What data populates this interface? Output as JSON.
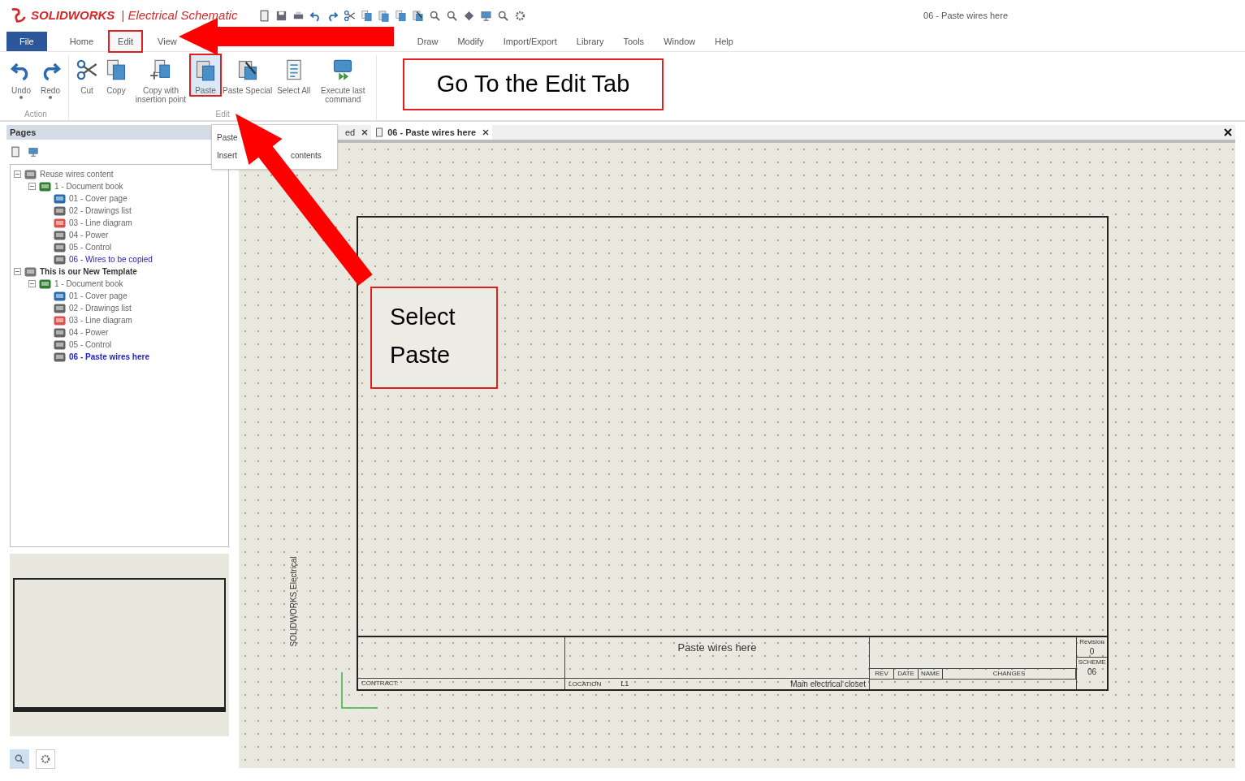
{
  "app": {
    "brand": "SOLIDWORKS",
    "separator": "|",
    "product": "Electrical Schematic",
    "document_title": "06 - Paste wires here"
  },
  "menu_tabs": [
    {
      "label": "File",
      "kind": "file",
      "selected": false
    },
    {
      "label": "Home",
      "kind": "tab",
      "selected": false
    },
    {
      "label": "Edit",
      "kind": "tab",
      "selected": true
    },
    {
      "label": "View",
      "kind": "tab",
      "selected": false
    },
    {
      "label": "Draw",
      "kind": "tab",
      "selected": false
    },
    {
      "label": "Modify",
      "kind": "tab",
      "selected": false
    },
    {
      "label": "Import/Export",
      "kind": "tab",
      "selected": false
    },
    {
      "label": "Library",
      "kind": "tab",
      "selected": false
    },
    {
      "label": "Tools",
      "kind": "tab",
      "selected": false
    },
    {
      "label": "Window",
      "kind": "tab",
      "selected": false
    },
    {
      "label": "Help",
      "kind": "tab",
      "selected": false
    }
  ],
  "ribbon": {
    "groups": [
      {
        "label": "Action",
        "buttons": [
          {
            "label": "Undo",
            "kind": "undo",
            "has_menu": true,
            "selected": false
          },
          {
            "label": "Redo",
            "kind": "redo",
            "has_menu": true,
            "selected": false
          }
        ]
      },
      {
        "label": "Edit",
        "buttons": [
          {
            "label": "Cut",
            "kind": "cut",
            "has_menu": false,
            "selected": false
          },
          {
            "label": "Copy",
            "kind": "copy",
            "has_menu": false,
            "selected": false
          },
          {
            "label": "Copy with insertion point",
            "kind": "copy-point",
            "has_menu": false,
            "selected": false
          },
          {
            "label": "Paste",
            "kind": "paste",
            "has_menu": false,
            "selected": true
          },
          {
            "label": "Paste Special",
            "kind": "paste-special",
            "has_menu": false,
            "selected": false
          },
          {
            "label": "Select All",
            "kind": "select-all",
            "has_menu": false,
            "selected": false
          },
          {
            "label": "Execute last command",
            "kind": "execute",
            "has_menu": false,
            "selected": false
          }
        ]
      }
    ]
  },
  "context_menu": {
    "items": [
      {
        "parts": [
          "Paste"
        ]
      },
      {
        "parts": [
          "Insert",
          "contents"
        ]
      }
    ]
  },
  "pages_panel": {
    "title": "Pages",
    "tree": [
      {
        "label": "Reuse wires content",
        "kind": "project",
        "expanded": true,
        "selected": false,
        "children": [
          {
            "label": "1 - Document book",
            "kind": "book",
            "expanded": true,
            "selected": false,
            "children": [
              {
                "label": "01 - Cover page",
                "kind": "cover",
                "selected": false,
                "open": false
              },
              {
                "label": "02 - Drawings list",
                "kind": "list",
                "selected": false,
                "open": false
              },
              {
                "label": "03 - Line diagram",
                "kind": "diagram",
                "selected": false,
                "open": false
              },
              {
                "label": "04 - Power",
                "kind": "schematic",
                "selected": false,
                "open": false
              },
              {
                "label": "05 - Control",
                "kind": "schematic",
                "selected": false,
                "open": false
              },
              {
                "label": "06 - Wires to be copied",
                "kind": "schematic",
                "selected": false,
                "open": true
              }
            ]
          }
        ]
      },
      {
        "label": "This is our New Template",
        "kind": "project",
        "expanded": true,
        "selected": true,
        "children": [
          {
            "label": "1 - Document book",
            "kind": "book",
            "expanded": true,
            "selected": false,
            "children": [
              {
                "label": "01 - Cover page",
                "kind": "cover",
                "selected": false,
                "open": false
              },
              {
                "label": "02 - Drawings list",
                "kind": "list",
                "selected": false,
                "open": false
              },
              {
                "label": "03 - Line diagram",
                "kind": "diagram",
                "selected": false,
                "open": false
              },
              {
                "label": "04 - Power",
                "kind": "schematic",
                "selected": false,
                "open": false
              },
              {
                "label": "05 - Control",
                "kind": "schematic",
                "selected": false,
                "open": false
              },
              {
                "label": "06 - Paste wires here",
                "kind": "schematic",
                "selected": true,
                "open": true
              }
            ]
          }
        ]
      }
    ]
  },
  "doc_tabs": [
    {
      "label": "ed",
      "selected": false
    },
    {
      "label": "06 - Paste wires here",
      "selected": true
    }
  ],
  "drawing": {
    "side_text": "SOLIDWORKS Electrical",
    "title": "Paste wires here",
    "contract_label": "CONTRACT:",
    "location_label": "LOCATION",
    "location": "L1",
    "location_description": "Main electrical closet",
    "rev_headers": [
      "REV",
      "DATE",
      "NAME",
      "CHANGES"
    ],
    "revision_label": "Revision",
    "revision": "0",
    "scheme_label": "SCHEME",
    "scheme": "06"
  },
  "annotations": [
    {
      "text": "Go To the Edit Tab"
    },
    {
      "text": "Select Paste"
    }
  ]
}
